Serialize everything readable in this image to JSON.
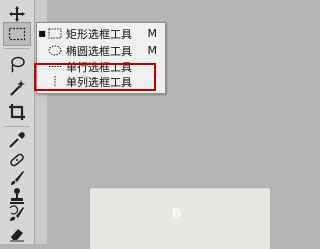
{
  "toolbar": {
    "tools": [
      {
        "name": "move-tool",
        "icon": "move-icon"
      },
      {
        "name": "marquee-tool",
        "icon": "rect-marquee-icon"
      },
      {
        "name": "lasso-tool",
        "icon": "lasso-icon"
      },
      {
        "name": "magic-wand-tool",
        "icon": "magic-wand-icon"
      },
      {
        "name": "crop-tool",
        "icon": "crop-icon"
      },
      {
        "name": "eyedropper-tool",
        "icon": "eyedropper-icon"
      },
      {
        "name": "healing-tool",
        "icon": "bandage-icon"
      },
      {
        "name": "brush-tool",
        "icon": "brush-icon"
      },
      {
        "name": "clone-stamp-tool",
        "icon": "stamp-icon"
      },
      {
        "name": "history-brush-tool",
        "icon": "history-brush-icon"
      },
      {
        "name": "eraser-tool",
        "icon": "eraser-icon"
      }
    ]
  },
  "flyout": {
    "items": [
      {
        "label": "矩形选框工具",
        "shortcut": "M",
        "icon": "rect-marquee-icon",
        "selected": true
      },
      {
        "label": "椭圆选框工具",
        "shortcut": "M",
        "icon": "ellipse-marquee-icon",
        "selected": false
      },
      {
        "label": "单行选框工具",
        "shortcut": "",
        "icon": "single-row-marquee-icon",
        "selected": false
      },
      {
        "label": "单列选框工具",
        "shortcut": "",
        "icon": "single-column-marquee-icon",
        "selected": false
      }
    ],
    "highlight_color": "#c40000"
  },
  "document": {
    "glyph": "B"
  }
}
